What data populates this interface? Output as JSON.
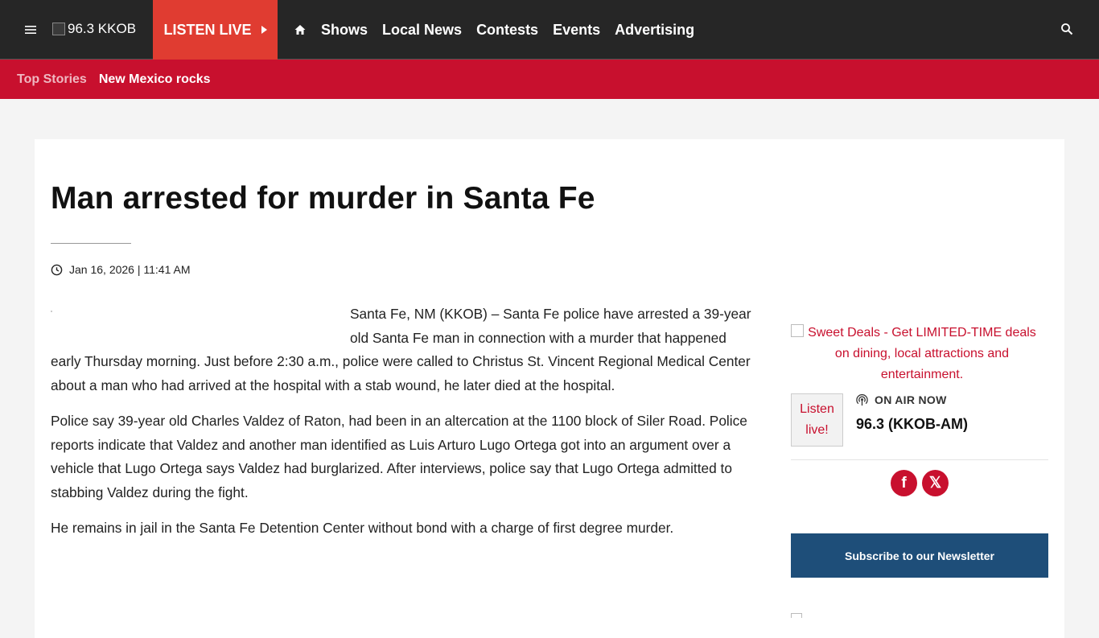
{
  "header": {
    "logo_text": "96.3 KKOB",
    "listen_live": "LISTEN LIVE",
    "nav": [
      "Shows",
      "Local News",
      "Contests",
      "Events",
      "Advertising"
    ]
  },
  "subnav": {
    "label": "Top Stories",
    "item": "New Mexico rocks"
  },
  "article": {
    "title": "Man arrested for murder in Santa Fe",
    "date": "Jan 16, 2026 | 11:41 AM",
    "paragraphs": [
      "Santa Fe, NM (KKOB) – Santa Fe police have arrested a 39-year old Santa Fe man in connection with a murder that happened early Thursday morning.   Just before 2:30 a.m., police were called to Christus St. Vincent Regional Medical Center about a man who had arrived at the hospital with a stab wound, he later died at the hospital.",
      "Police say 39-year old Charles Valdez of Raton, had been in an altercation at the 1100 block of Siler Road. Police reports indicate that Valdez and another man identified as Luis Arturo Lugo Ortega got into an argument over a vehicle that Lugo Ortega says Valdez had burglarized. After interviews, police say that Lugo Ortega admitted to stabbing Valdez during the fight.",
      "He remains in jail in the Santa Fe Detention Center without bond with a charge of first degree murder."
    ]
  },
  "sidebar": {
    "promo_text": "Sweet Deals - Get LIMITED-TIME deals on dining, local attractions and entertainment.",
    "thumb_alt": "Listen live!",
    "on_air_label": "ON AIR NOW",
    "station": "96.3 (KKOB-AM)",
    "social": {
      "facebook": "f",
      "x": "𝕏"
    },
    "newsletter": "Subscribe to our Newsletter"
  },
  "colors": {
    "topbar": "#262626",
    "accent_red": "#c8102e",
    "listen_live_bg": "#e03c31",
    "newsletter_bg": "#1e4e79"
  }
}
